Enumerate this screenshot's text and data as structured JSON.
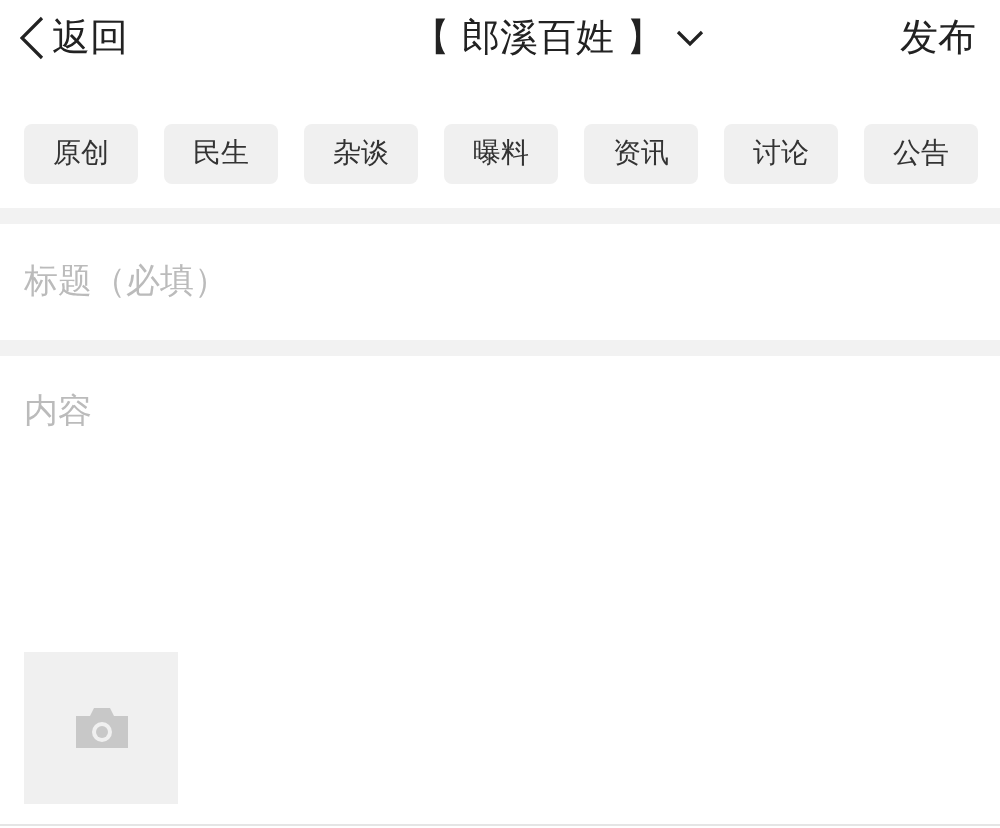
{
  "header": {
    "back": "返回",
    "title": "【 郎溪百姓 】",
    "publish": "发布"
  },
  "tags": [
    {
      "label": "原创"
    },
    {
      "label": "民生"
    },
    {
      "label": "杂谈"
    },
    {
      "label": "曝料"
    },
    {
      "label": "资讯"
    },
    {
      "label": "讨论"
    },
    {
      "label": "公告"
    }
  ],
  "title_field": {
    "placeholder": "标题（必填）"
  },
  "content_field": {
    "placeholder": "内容"
  }
}
